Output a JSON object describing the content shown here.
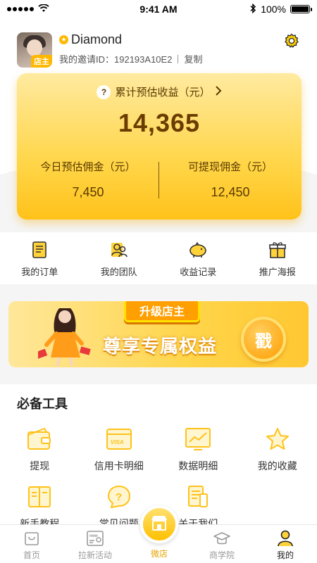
{
  "status": {
    "time": "9:41 AM",
    "battery": "100%"
  },
  "profile": {
    "name": "Diamond",
    "avatar_tag": "店主",
    "invite_label": "我的邀请ID：",
    "invite_id": "192193A10E2",
    "copy_label": "复制",
    "badge_icon": "star-icon"
  },
  "earnings": {
    "title": "累计预估收益（元）",
    "total": "14,365",
    "today_label": "今日预估佣金（元）",
    "today_value": "7,450",
    "withdraw_label": "可提现佣金（元）",
    "withdraw_value": "12,450"
  },
  "quick_actions": [
    {
      "label": "我的订单",
      "icon": "order-icon"
    },
    {
      "label": "我的团队",
      "icon": "team-icon"
    },
    {
      "label": "收益记录",
      "icon": "piggy-bank-icon"
    },
    {
      "label": "推广海报",
      "icon": "gift-icon"
    }
  ],
  "banner": {
    "ribbon": "升级店主",
    "title": "尊享专属权益",
    "button": "戳"
  },
  "tools": {
    "title": "必备工具",
    "items": [
      {
        "label": "提现",
        "icon": "wallet-icon"
      },
      {
        "label": "信用卡明细",
        "icon": "credit-card-icon"
      },
      {
        "label": "数据明细",
        "icon": "chart-icon"
      },
      {
        "label": "我的收藏",
        "icon": "star-icon"
      },
      {
        "label": "新手教程",
        "icon": "book-icon"
      },
      {
        "label": "常见问题",
        "icon": "question-icon"
      },
      {
        "label": "关于我们",
        "icon": "document-icon"
      }
    ]
  },
  "tabbar": {
    "items": [
      {
        "label": "首页",
        "icon": "home-icon"
      },
      {
        "label": "拉新活动",
        "icon": "new-activity-icon"
      },
      {
        "label": "微店",
        "icon": "shop-icon"
      },
      {
        "label": "商学院",
        "icon": "graduation-cap-icon"
      },
      {
        "label": "我的",
        "icon": "user-icon"
      }
    ],
    "active": "我的"
  },
  "colors": {
    "accent": "#ffc21a",
    "brown": "#5a3a00",
    "banner_orange": "#ff9f00"
  }
}
